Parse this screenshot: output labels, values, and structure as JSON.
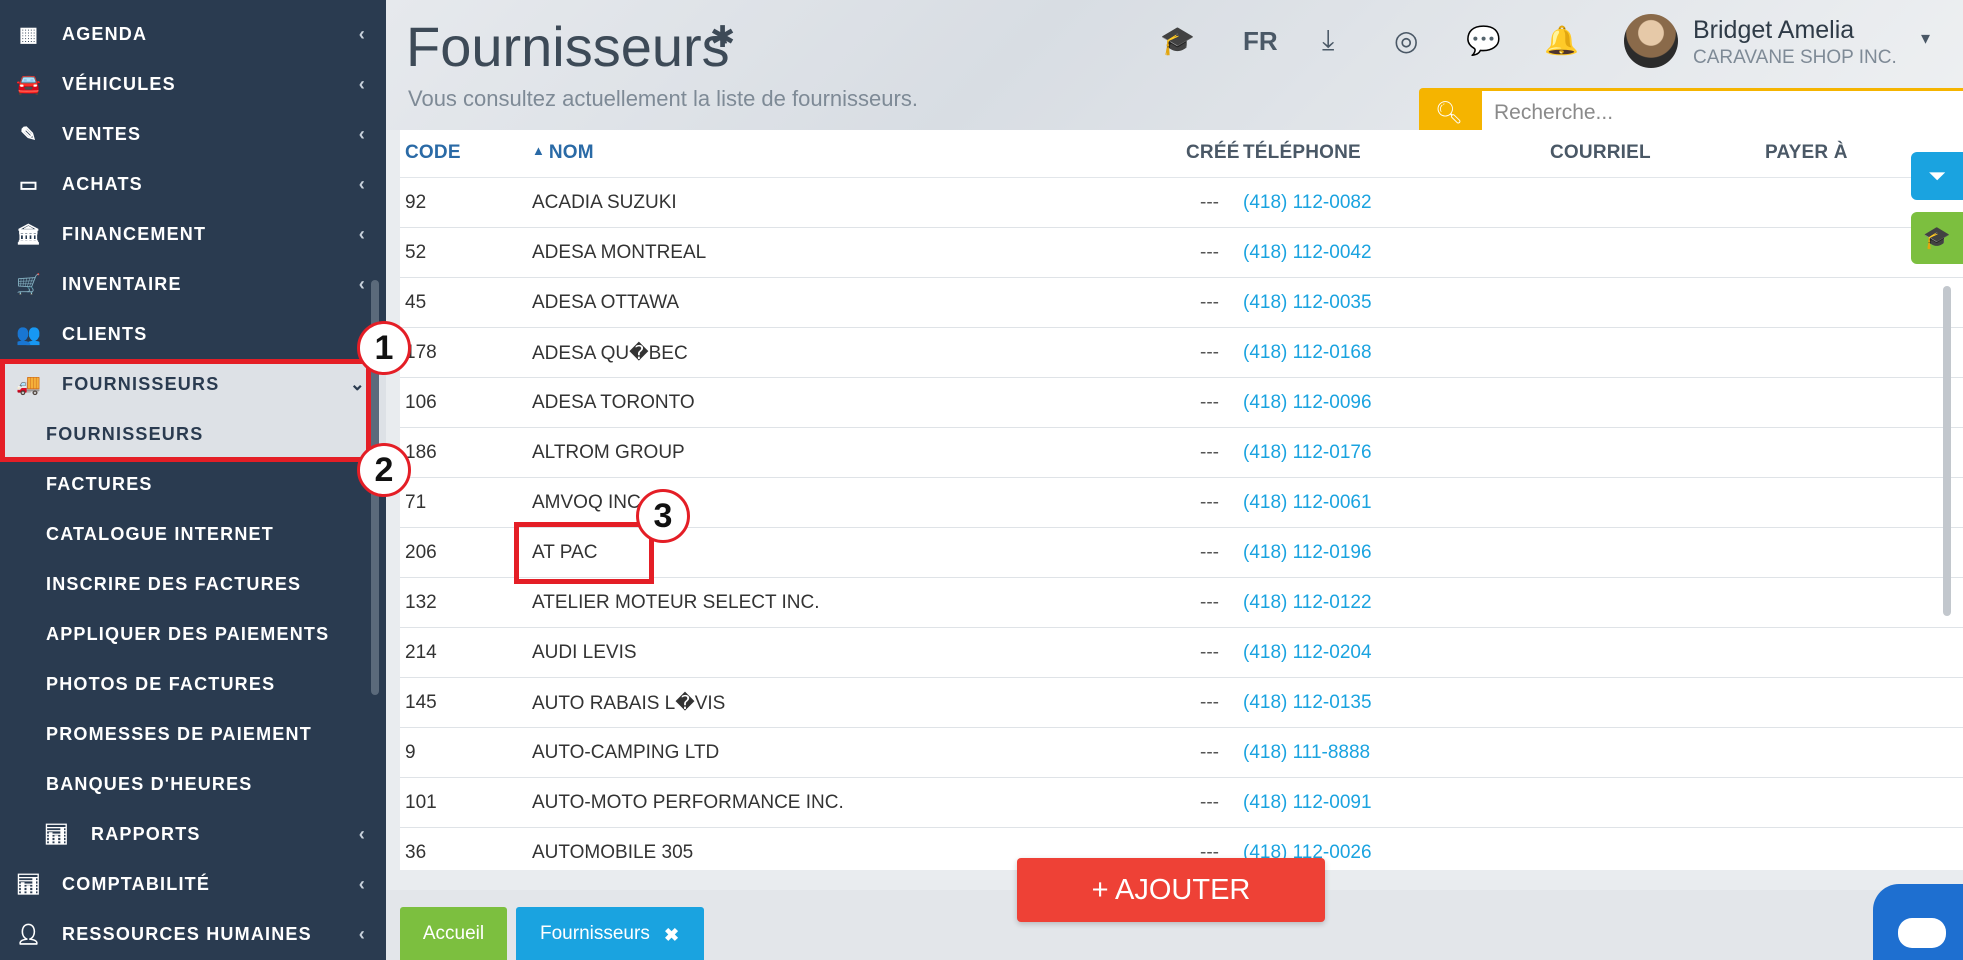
{
  "sidebar": {
    "items": [
      {
        "label": "AGENDA",
        "icon": "calendar-icon",
        "glyph": "▦"
      },
      {
        "label": "VÉHICULES",
        "icon": "car-icon",
        "glyph": "🚘"
      },
      {
        "label": "VENTES",
        "icon": "edit-icon",
        "glyph": "✎"
      },
      {
        "label": "ACHATS",
        "icon": "credit-card-icon",
        "glyph": "▭"
      },
      {
        "label": "FINANCEMENT",
        "icon": "bank-icon",
        "glyph": "🏛"
      },
      {
        "label": "INVENTAIRE",
        "icon": "cart-icon",
        "glyph": "🛒"
      },
      {
        "label": "CLIENTS",
        "icon": "users-icon",
        "glyph": "👥"
      },
      {
        "label": "FOURNISSEURS",
        "icon": "truck-icon",
        "glyph": "🚚"
      }
    ],
    "sub_items": [
      {
        "label": "FOURNISSEURS"
      },
      {
        "label": "FACTURES"
      },
      {
        "label": "CATALOGUE INTERNET"
      },
      {
        "label": "INSCRIRE DES FACTURES"
      },
      {
        "label": "APPLIQUER DES PAIEMENTS"
      },
      {
        "label": "PHOTOS DE FACTURES"
      },
      {
        "label": "PROMESSES DE PAIEMENT"
      },
      {
        "label": "BANQUES D'HEURES"
      },
      {
        "label": "RAPPORTS",
        "icon": "bar-chart-icon"
      }
    ],
    "bottom_items": [
      {
        "label": "COMPTABILITÉ",
        "icon": "bar-chart-icon"
      },
      {
        "label": "RESSOURCES HUMAINES",
        "icon": "user-icon"
      }
    ]
  },
  "header": {
    "title": "Fournisseurs",
    "subtitle": "Vous consultez actuellement la liste de fournisseurs.",
    "lang": "FR",
    "user_name": "Bridget Amelia",
    "company": "CARAVANE SHOP INC."
  },
  "search": {
    "placeholder": "Recherche..."
  },
  "table": {
    "columns": {
      "code": "CODE",
      "nom": "NOM",
      "cree": "CRÉÉ",
      "telephone": "TÉLÉPHONE",
      "courriel": "COURRIEL",
      "payer": "PAYER À"
    },
    "rows": [
      {
        "code": "92",
        "nom": "ACADIA SUZUKI",
        "cree": "---",
        "tel": "(418) 112-0082"
      },
      {
        "code": "52",
        "nom": "ADESA MONTREAL",
        "cree": "---",
        "tel": "(418) 112-0042"
      },
      {
        "code": "45",
        "nom": "ADESA OTTAWA",
        "cree": "---",
        "tel": "(418) 112-0035"
      },
      {
        "code": "178",
        "nom": "ADESA QU�BEC",
        "cree": "---",
        "tel": "(418) 112-0168"
      },
      {
        "code": "106",
        "nom": "ADESA TORONTO",
        "cree": "---",
        "tel": "(418) 112-0096"
      },
      {
        "code": "186",
        "nom": "ALTROM GROUP",
        "cree": "---",
        "tel": "(418) 112-0176"
      },
      {
        "code": "71",
        "nom": "AMVOQ INC.",
        "cree": "---",
        "tel": "(418) 112-0061"
      },
      {
        "code": "206",
        "nom": "AT PAC",
        "cree": "---",
        "tel": "(418) 112-0196"
      },
      {
        "code": "132",
        "nom": "ATELIER MOTEUR SELECT INC.",
        "cree": "---",
        "tel": "(418) 112-0122"
      },
      {
        "code": "214",
        "nom": "AUDI LEVIS",
        "cree": "---",
        "tel": "(418) 112-0204"
      },
      {
        "code": "145",
        "nom": "AUTO RABAIS L�VIS",
        "cree": "---",
        "tel": "(418) 112-0135"
      },
      {
        "code": "9",
        "nom": "AUTO-CAMPING LTD",
        "cree": "---",
        "tel": "(418) 111-8888"
      },
      {
        "code": "101",
        "nom": "AUTO-MOTO PERFORMANCE INC.",
        "cree": "---",
        "tel": "(418) 112-0091"
      },
      {
        "code": "36",
        "nom": "AUTOMOBILE 305",
        "cree": "---",
        "tel": "(418) 112-0026"
      }
    ]
  },
  "add_button": "+ AJOUTER",
  "tabs": {
    "home": "Accueil",
    "current": "Fournisseurs"
  },
  "annotations": [
    "1",
    "2",
    "3"
  ],
  "colors": {
    "sidebar": "#2a3b50",
    "accent_blue": "#1aa3e0",
    "accent_yellow": "#f5b400",
    "add_red": "#ee4136",
    "highlight": "#e41e26",
    "home_green": "#7cbf3f"
  }
}
